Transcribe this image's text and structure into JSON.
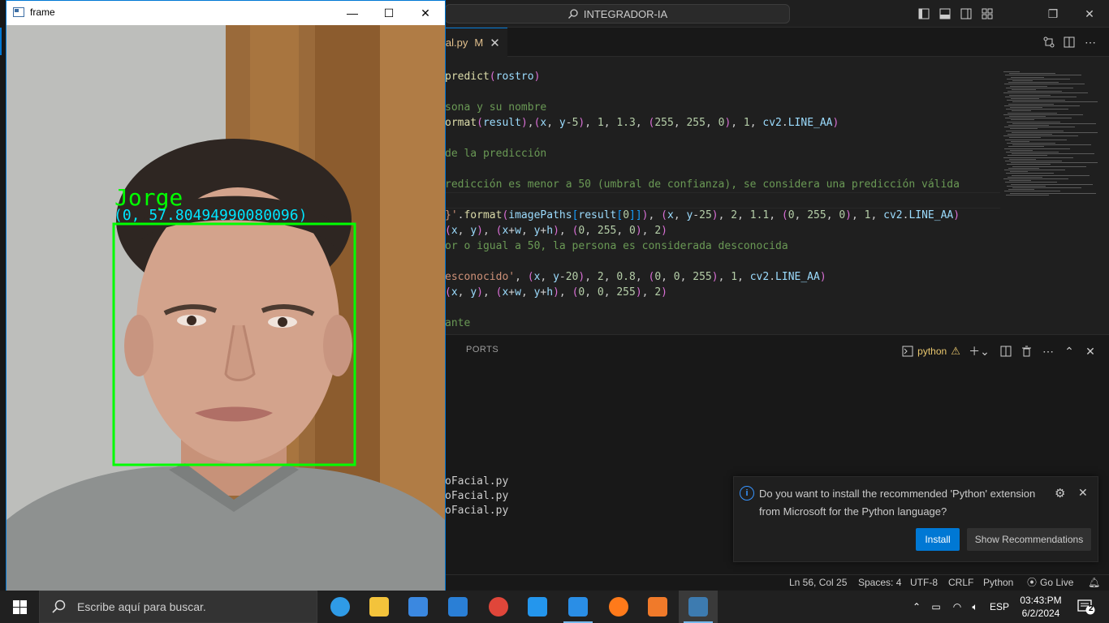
{
  "vscode": {
    "command_center": "INTEGRADOR-IA",
    "active_tab": {
      "name": "ial.py",
      "status": "M"
    },
    "code_lines": [
      {
        "parts": [
          [
            "c-fn",
            "predict"
          ],
          [
            "c-paren",
            "("
          ],
          [
            "c-var",
            "rostro"
          ],
          [
            "c-paren",
            ")"
          ]
        ]
      },
      {
        "parts": [
          [
            "c-cm",
            "sona y su nombre"
          ]
        ]
      },
      {
        "parts": [
          [
            "c-fn",
            "ormat"
          ],
          [
            "c-paren",
            "("
          ],
          [
            "c-var",
            "result"
          ],
          [
            "c-paren",
            ")"
          ],
          [
            "",
            ","
          ],
          [
            "c-paren",
            "("
          ],
          [
            "c-var",
            "x"
          ],
          [
            "",
            ", "
          ],
          [
            "c-var",
            "y"
          ],
          [
            "",
            "-"
          ],
          [
            "c-num",
            "5"
          ],
          [
            "c-paren",
            ")"
          ],
          [
            "",
            ", "
          ],
          [
            "c-num",
            "1"
          ],
          [
            "",
            ", "
          ],
          [
            "c-num",
            "1.3"
          ],
          [
            "",
            ", "
          ],
          [
            "c-paren",
            "("
          ],
          [
            "c-num",
            "255"
          ],
          [
            "",
            ", "
          ],
          [
            "c-num",
            "255"
          ],
          [
            "",
            ", "
          ],
          [
            "c-num",
            "0"
          ],
          [
            "c-paren",
            ")"
          ],
          [
            "",
            ", "
          ],
          [
            "c-num",
            "1"
          ],
          [
            "",
            ", "
          ],
          [
            "c-var",
            "cv2"
          ],
          [
            "",
            "."
          ],
          [
            "c-var",
            "LINE_AA"
          ],
          [
            "c-paren",
            ")"
          ]
        ]
      },
      {
        "parts": [
          [
            "c-cm",
            "de la predicción"
          ]
        ]
      },
      {
        "parts": [
          [
            "c-cm",
            "redicción es menor a 50 (umbral de confianza), se considera una predicción válida"
          ]
        ]
      },
      {
        "parts": [
          [
            "c-str",
            "}'"
          ],
          [
            "",
            "."
          ],
          [
            "c-fn",
            "format"
          ],
          [
            "c-paren",
            "("
          ],
          [
            "c-var",
            "imagePaths"
          ],
          [
            "c-br",
            "["
          ],
          [
            "c-var",
            "result"
          ],
          [
            "c-br",
            "["
          ],
          [
            "c-num",
            "0"
          ],
          [
            "c-br",
            "]]"
          ],
          [
            "c-paren",
            ")"
          ],
          [
            "",
            ", "
          ],
          [
            "c-paren",
            "("
          ],
          [
            "c-var",
            "x"
          ],
          [
            "",
            ", "
          ],
          [
            "c-var",
            "y"
          ],
          [
            "",
            "-"
          ],
          [
            "c-num",
            "25"
          ],
          [
            "c-paren",
            ")"
          ],
          [
            "",
            ", "
          ],
          [
            "c-num",
            "2"
          ],
          [
            "",
            ", "
          ],
          [
            "c-num",
            "1.1"
          ],
          [
            "",
            ", "
          ],
          [
            "c-paren",
            "("
          ],
          [
            "c-num",
            "0"
          ],
          [
            "",
            ", "
          ],
          [
            "c-num",
            "255"
          ],
          [
            "",
            ", "
          ],
          [
            "c-num",
            "0"
          ],
          [
            "c-paren",
            ")"
          ],
          [
            "",
            ", "
          ],
          [
            "c-num",
            "1"
          ],
          [
            "",
            ", "
          ],
          [
            "c-var",
            "cv2"
          ],
          [
            "",
            "."
          ],
          [
            "c-var",
            "LINE_AA"
          ],
          [
            "c-paren",
            ")"
          ]
        ]
      },
      {
        "parts": [
          [
            "c-paren",
            "("
          ],
          [
            "c-var",
            "x"
          ],
          [
            "",
            ", "
          ],
          [
            "c-var",
            "y"
          ],
          [
            "c-paren",
            ")"
          ],
          [
            "",
            ", "
          ],
          [
            "c-paren",
            "("
          ],
          [
            "c-var",
            "x"
          ],
          [
            "",
            "+"
          ],
          [
            "c-var",
            "w"
          ],
          [
            "",
            ", "
          ],
          [
            "c-var",
            "y"
          ],
          [
            "",
            "+"
          ],
          [
            "c-var",
            "h"
          ],
          [
            "c-paren",
            ")"
          ],
          [
            "",
            ", "
          ],
          [
            "c-paren",
            "("
          ],
          [
            "c-num",
            "0"
          ],
          [
            "",
            ", "
          ],
          [
            "c-num",
            "255"
          ],
          [
            "",
            ", "
          ],
          [
            "c-num",
            "0"
          ],
          [
            "c-paren",
            ")"
          ],
          [
            "",
            ", "
          ],
          [
            "c-num",
            "2"
          ],
          [
            "c-paren",
            ")"
          ]
        ]
      },
      {
        "parts": [
          [
            "c-cm",
            "or o igual a 50, la persona es considerada desconocida"
          ]
        ]
      },
      {
        "parts": [
          [
            "c-str",
            "esconocido'"
          ],
          [
            "",
            ", "
          ],
          [
            "c-paren",
            "("
          ],
          [
            "c-var",
            "x"
          ],
          [
            "",
            ", "
          ],
          [
            "c-var",
            "y"
          ],
          [
            "",
            "-"
          ],
          [
            "c-num",
            "20"
          ],
          [
            "c-paren",
            ")"
          ],
          [
            "",
            ", "
          ],
          [
            "c-num",
            "2"
          ],
          [
            "",
            ", "
          ],
          [
            "c-num",
            "0.8"
          ],
          [
            "",
            ", "
          ],
          [
            "c-paren",
            "("
          ],
          [
            "c-num",
            "0"
          ],
          [
            "",
            ", "
          ],
          [
            "c-num",
            "0"
          ],
          [
            "",
            ", "
          ],
          [
            "c-num",
            "255"
          ],
          [
            "c-paren",
            ")"
          ],
          [
            "",
            ", "
          ],
          [
            "c-num",
            "1"
          ],
          [
            "",
            ", "
          ],
          [
            "c-var",
            "cv2"
          ],
          [
            "",
            "."
          ],
          [
            "c-var",
            "LINE_AA"
          ],
          [
            "c-paren",
            ")"
          ]
        ]
      },
      {
        "parts": [
          [
            "c-paren",
            "("
          ],
          [
            "c-var",
            "x"
          ],
          [
            "",
            ", "
          ],
          [
            "c-var",
            "y"
          ],
          [
            "c-paren",
            ")"
          ],
          [
            "",
            ", "
          ],
          [
            "c-paren",
            "("
          ],
          [
            "c-var",
            "x"
          ],
          [
            "",
            "+"
          ],
          [
            "c-var",
            "w"
          ],
          [
            "",
            ", "
          ],
          [
            "c-var",
            "y"
          ],
          [
            "",
            "+"
          ],
          [
            "c-var",
            "h"
          ],
          [
            "c-paren",
            ")"
          ],
          [
            "",
            ", "
          ],
          [
            "c-paren",
            "("
          ],
          [
            "c-num",
            "0"
          ],
          [
            "",
            ", "
          ],
          [
            "c-num",
            "0"
          ],
          [
            "",
            ", "
          ],
          [
            "c-num",
            "255"
          ],
          [
            "c-paren",
            ")"
          ],
          [
            "",
            ", "
          ],
          [
            "c-num",
            "2"
          ],
          [
            "c-paren",
            ")"
          ]
        ]
      },
      {
        "parts": [
          [
            "c-cm",
            "ante"
          ]
        ]
      }
    ],
    "panel": {
      "ports_tab": "PORTS",
      "terminal_name": "python",
      "terminal_lines": [
        "oFacial.py",
        "oFacial.py",
        "oFacial.py"
      ]
    },
    "notification": {
      "message": "Do you want to install the recommended 'Python' extension from Microsoft for the Python language?",
      "install": "Install",
      "show": "Show Recommendations"
    },
    "statusbar": {
      "position": "Ln 56, Col 25",
      "spaces": "Spaces: 4",
      "encoding": "UTF-8",
      "eol": "CRLF",
      "language": "Python",
      "golive": "Go Live"
    }
  },
  "frame_window": {
    "title": "frame",
    "overlay_name": "Jorge",
    "overlay_result": "(0, 57.80494990080096)",
    "name_color": "#00ff00",
    "result_color": "#ffff00",
    "box_color": "#00ff00"
  },
  "taskbar": {
    "search_placeholder": "Escribe aquí para buscar.",
    "language": "ESP",
    "time": "03:43:PM",
    "date": "6/2/2024",
    "notification_count": "2",
    "apps": [
      "edge-icon",
      "file-explorer-icon",
      "store-icon",
      "mail-icon",
      "chrome-icon",
      "docker-icon",
      "vscode-icon",
      "firefox-icon",
      "xampp-icon",
      "python-icon"
    ]
  }
}
